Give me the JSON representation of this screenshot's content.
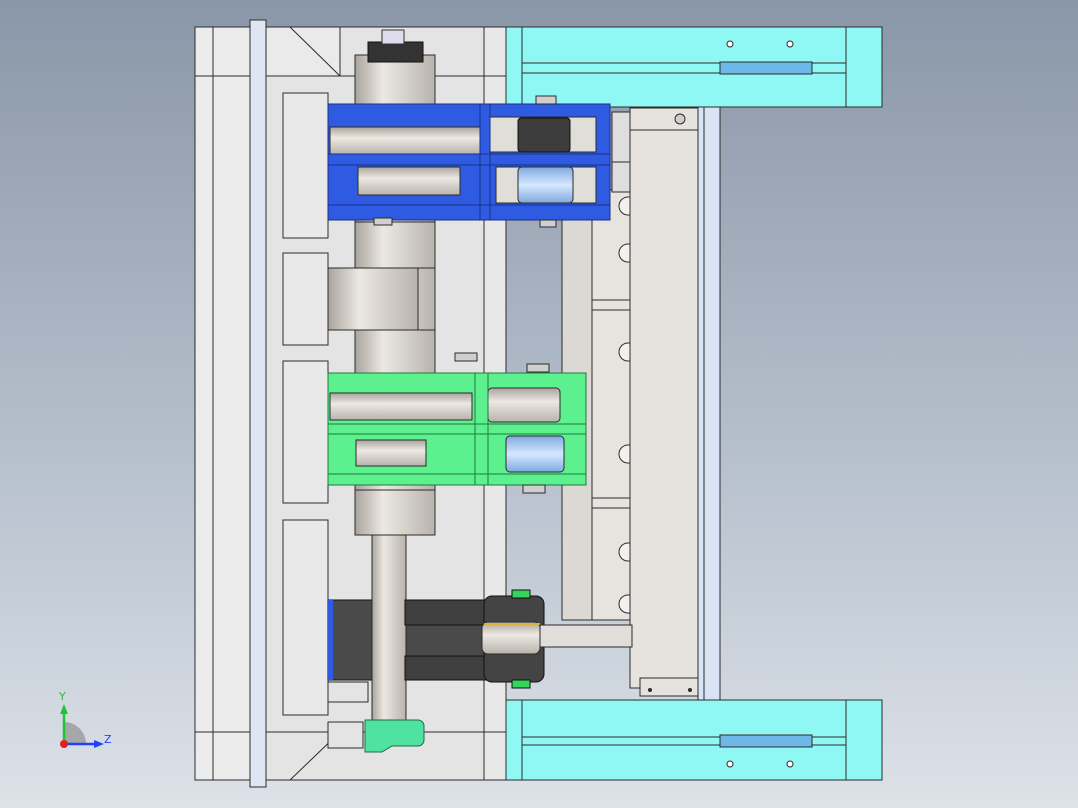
{
  "viewport": {
    "background_top": "#8a97a8",
    "background_bottom": "#dde2e8"
  },
  "colors": {
    "plate_gray": "#e6e6e6",
    "edge": "#2b2b2b",
    "cyan_block": "#8ff8f5",
    "blue_linkage": "#2f5be3",
    "green_linkage": "#5cf08e",
    "shaft": "#d6d2cc",
    "dark_cylinder": "#4a4a4a",
    "rail_light_blue": "#d8e4f5"
  },
  "triad": {
    "icon": "coordinate-triad-icon",
    "y_label": "Y",
    "z_label": "Z",
    "y_color": "#21c233",
    "z_color": "#2041ff",
    "x_color": "#e01f1f"
  }
}
